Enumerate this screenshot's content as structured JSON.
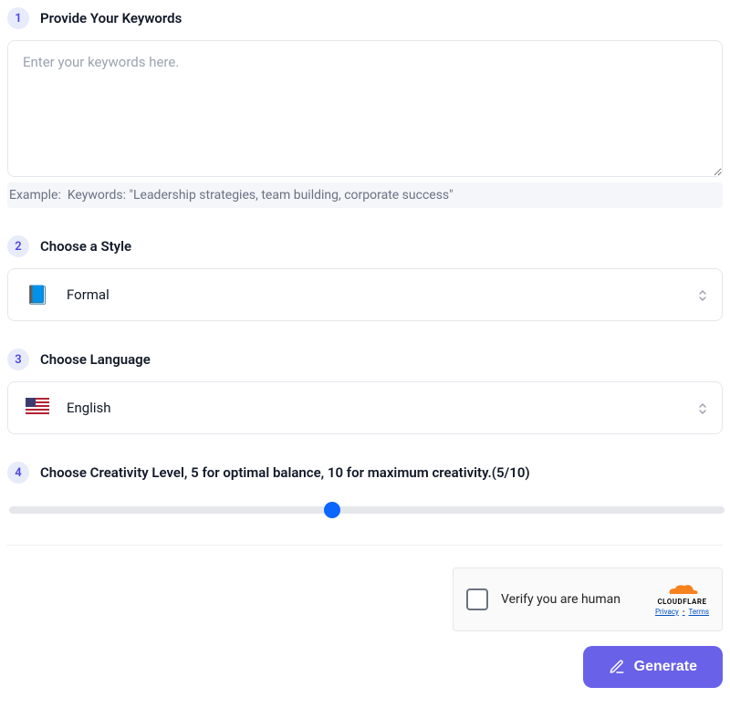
{
  "step1": {
    "num": "1",
    "title": "Provide Your Keywords",
    "placeholder": "Enter your keywords here.",
    "example_label": "Example:",
    "example_text": "Keywords: \"Leadership strategies, team building, corporate success\""
  },
  "step2": {
    "num": "2",
    "title": "Choose a Style",
    "value": "Formal"
  },
  "step3": {
    "num": "3",
    "title": "Choose Language",
    "value": "English"
  },
  "step4": {
    "num": "4",
    "title": "Choose Creativity Level, 5 for optimal balance, 10 for maximum creativity.(5/10)",
    "slider_min": "0",
    "slider_max": "10",
    "slider_value": "4.5"
  },
  "captcha": {
    "text": "Verify you are human",
    "brand": "CLOUDFLARE",
    "privacy": "Privacy",
    "terms": "Terms"
  },
  "generate_label": "Generate"
}
